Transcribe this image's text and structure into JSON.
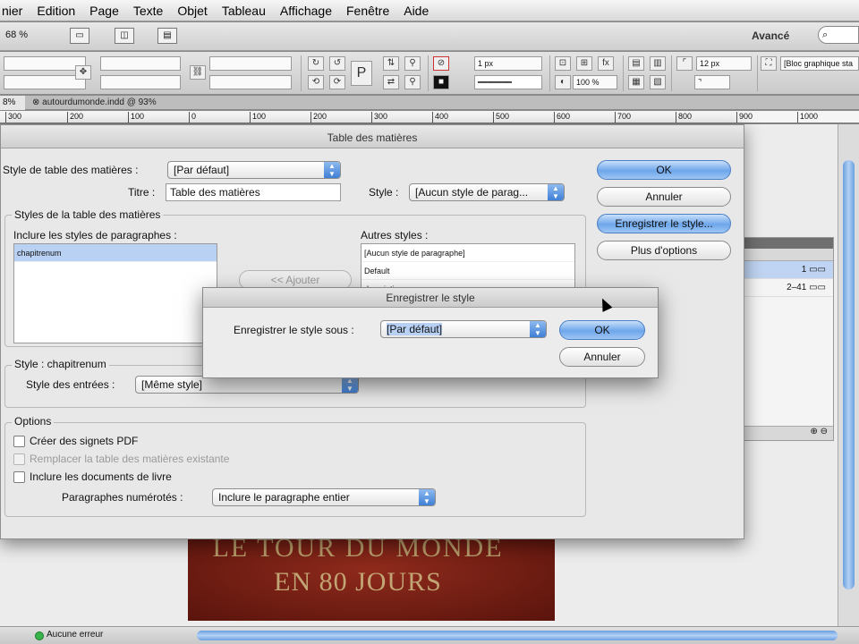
{
  "menubar": {
    "items": [
      "nier",
      "Edition",
      "Page",
      "Texte",
      "Objet",
      "Tableau",
      "Affichage",
      "Fenêtre",
      "Aide"
    ]
  },
  "app_toolbar": {
    "zoom": "68 %",
    "workspace": "Avancé",
    "search_icon": "⌕"
  },
  "control_panel": {
    "stroke_weight": "1 px",
    "scale": "100 %",
    "spacing": "12 px",
    "object_style": "[Bloc graphique sta"
  },
  "tabs": {
    "active_tab": "8%",
    "doc_tab": "autourdumonde.indd @ 93%"
  },
  "ruler": {
    "labels": [
      "300",
      "200",
      "100",
      "0",
      "100",
      "200",
      "300",
      "400",
      "500",
      "600",
      "700",
      "800",
      "900",
      "1000"
    ]
  },
  "dialog": {
    "title": "Table des matières",
    "toc_style_label": "Style de table des matières :",
    "toc_style_value": "[Par défaut]",
    "title_label": "Titre :",
    "title_value": "Table des matières",
    "style_label": "Style :",
    "style_value": "[Aucun style de parag...",
    "styles_group_label": "Styles de la table des matières",
    "include_label": "Inclure les styles de paragraphes :",
    "included_styles": [
      "chapitrenum"
    ],
    "add_button": "<< Ajouter",
    "other_styles_label": "Autres styles :",
    "other_styles": [
      "[Aucun style de paragraphe]",
      "Default",
      "description"
    ],
    "entry_group_label": "Style : chapitrenum",
    "entry_style_label": "Style des entrées :",
    "entry_style_value": "[Même style]",
    "options_label": "Options",
    "opt_bookmarks": "Créer des signets PDF",
    "opt_replace": "Remplacer la table des matières existante",
    "opt_include_docs": "Inclure les documents de livre",
    "numbered_label": "Paragraphes numérotés :",
    "numbered_value": "Inclure le paragraphe entier",
    "buttons": {
      "ok": "OK",
      "cancel": "Annuler",
      "save_style": "Enregistrer le style...",
      "more_options": "Plus d'options"
    }
  },
  "save_dialog": {
    "title": "Enregistrer le style",
    "label": "Enregistrer le style sous :",
    "value": "[Par défaut]",
    "ok": "OK",
    "cancel": "Annuler"
  },
  "side_panel": {
    "rows": [
      "1",
      "2–41"
    ]
  },
  "cover": {
    "line1": "LE TOUR DU MONDE",
    "line2": "EN 80 JOURS"
  },
  "statusbar": {
    "status": "Aucune erreur"
  },
  "colors": {
    "accent_blue": "#6da6ea",
    "status_green": "#37b44a",
    "cover_red": "#8e2a1c"
  }
}
